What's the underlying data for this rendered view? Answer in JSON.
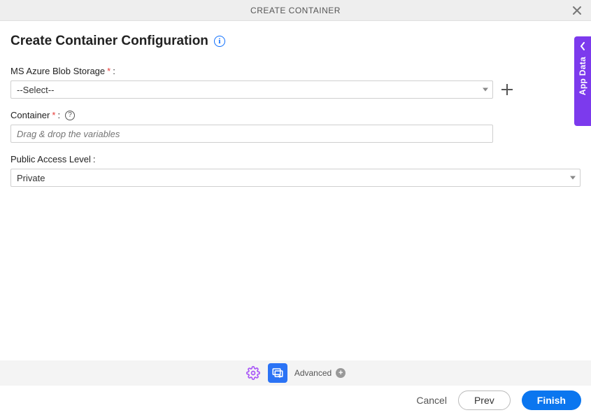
{
  "modal": {
    "title": "CREATE CONTAINER"
  },
  "heading": "Create Container Configuration",
  "fields": {
    "storage": {
      "label": "MS Azure Blob Storage",
      "required_marker": "*",
      "colon": ":",
      "selected": "--Select--"
    },
    "container": {
      "label": "Container",
      "required_marker": "*",
      "colon": ":",
      "placeholder": "Drag & drop the variables"
    },
    "access": {
      "label": "Public Access Level",
      "colon": ":",
      "selected": "Private"
    }
  },
  "side_panel": {
    "label": "App Data"
  },
  "toolbar": {
    "advanced_label": "Advanced"
  },
  "footer": {
    "cancel": "Cancel",
    "prev": "Prev",
    "finish": "Finish"
  }
}
